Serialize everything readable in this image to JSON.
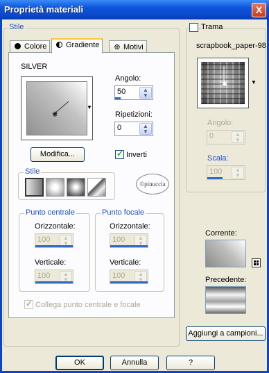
{
  "window": {
    "title": "Proprietà materiali",
    "close_label": "X"
  },
  "stile": {
    "group_label": "Stile",
    "tabs": [
      {
        "label": "Colore",
        "icon": "circle-icon"
      },
      {
        "label": "Gradiente",
        "icon": "half-circle-icon"
      },
      {
        "label": "Motivi",
        "icon": "crosshair-icon"
      }
    ],
    "active_tab": "Gradiente",
    "gradient_name": "SILVER",
    "angolo": {
      "label": "Angolo:",
      "value": "50",
      "level": 0.14
    },
    "ripetizioni": {
      "label": "Ripetizioni:",
      "value": "0"
    },
    "edit_button": "Modifica...",
    "inverti": {
      "label": "Inverti",
      "checked": true
    },
    "style_group": {
      "label": "Stile",
      "options": [
        "lineare",
        "rettangolare",
        "circolare",
        "angolare"
      ]
    },
    "punto_centrale": {
      "label": "Punto centrale",
      "oriz_label": "Orizzontale:",
      "oriz_value": "100",
      "vert_label": "Verticale:",
      "vert_value": "100"
    },
    "punto_focale": {
      "label": "Punto focale",
      "oriz_label": "Orizzontale:",
      "oriz_value": "100",
      "vert_label": "Verticale:",
      "vert_value": "100"
    },
    "collega": {
      "label": "Collega punto centrale e focale",
      "checked": true,
      "enabled": false
    }
  },
  "trama": {
    "label": "Trama",
    "checked": false,
    "pattern_name": "scrapbook_paper-98",
    "angolo": {
      "label": "Angolo:",
      "value": "0"
    },
    "scala": {
      "label": "Scala:",
      "value": "100"
    }
  },
  "corrente_label": "Corrente:",
  "precedente_label": "Precedente:",
  "add_swatches_button": "Aggiungi a campioni...",
  "footer": {
    "ok": "OK",
    "cancel": "Annulla",
    "help": "?"
  },
  "watermark": "©pinuccia",
  "colors": {
    "title_bar": "#0a46c8",
    "group_label": "#1f4fc3",
    "tab_highlight": "#ffc83c"
  }
}
